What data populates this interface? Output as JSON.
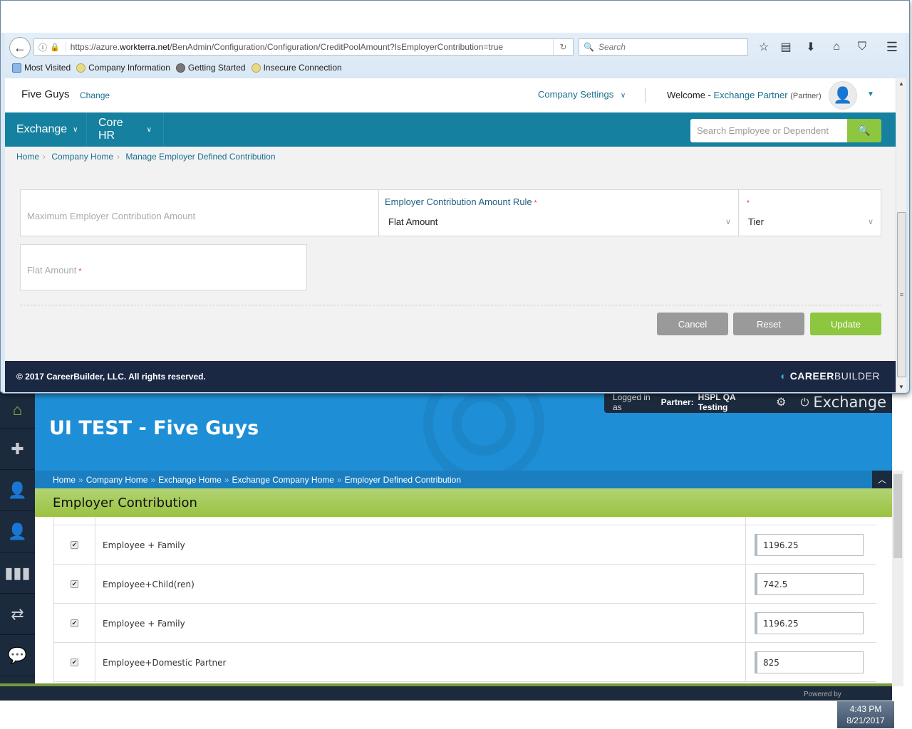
{
  "browser": {
    "url_prefix": "https://azure.",
    "url_domain": "workterra.net",
    "url_path": "/BenAdmin/Configuration/Configuration/CreditPoolAmount?IsEmployerContribution=true",
    "search_placeholder": "Search",
    "bookmarks": [
      "Most Visited",
      "Company Information",
      "Getting Started",
      "Insecure Connection"
    ]
  },
  "header": {
    "company": "Five Guys",
    "change_label": "Change",
    "company_settings": "Company Settings",
    "welcome": "Welcome - ",
    "user_name": "Exchange Partner",
    "user_role": "(Partner)"
  },
  "nav": {
    "items": [
      "Exchange",
      "Core HR"
    ],
    "search_placeholder": "Search Employee or Dependent"
  },
  "breadcrumb": [
    "Home",
    "Company Home",
    "Manage Employer Defined Contribution"
  ],
  "form": {
    "max_amount_placeholder": "Maximum Employer Contribution Amount",
    "rule_label": "Employer Contribution Amount Rule",
    "rule_value": "Flat Amount",
    "tier_label": "",
    "tier_value": "Tier",
    "flat_amount_label": "Flat Amount",
    "required_mark": "*"
  },
  "buttons": {
    "cancel": "Cancel",
    "reset": "Reset",
    "update": "Update"
  },
  "footer": {
    "copyright": "© 2017 CareerBuilder, LLC. All rights reserved.",
    "logo_bold": "CAREER",
    "logo_light": "BUILDER"
  },
  "background_app": {
    "title": "UI TEST - Five Guys",
    "logged_in_prefix": "Logged in as",
    "logged_in_role": "Partner:",
    "logged_in_user": "HSPL QA Testing",
    "app_name": "Exchange",
    "breadcrumb": [
      "Home",
      "Company Home",
      "Exchange Home",
      "Exchange Company Home",
      "Employer Defined Contribution"
    ],
    "section_title": "Employer Contribution",
    "rows": [
      {
        "checked": true,
        "tier": "Employee + Family",
        "amount": "1196.25"
      },
      {
        "checked": true,
        "tier": "Employee+Child(ren)",
        "amount": "742.5"
      },
      {
        "checked": true,
        "tier": "Employee + Family",
        "amount": "1196.25"
      },
      {
        "checked": true,
        "tier": "Employee+Domestic Partner",
        "amount": "825"
      }
    ],
    "footer_text": "Powered by"
  },
  "taskbar": {
    "time": "4:43 PM",
    "date": "8/21/2017"
  }
}
